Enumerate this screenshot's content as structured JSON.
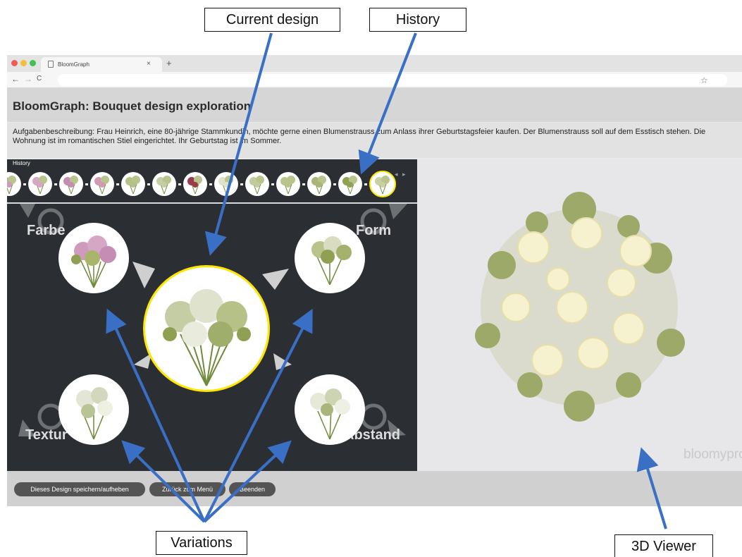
{
  "browser": {
    "tab_title": "BloomGraph",
    "tab_close": "×",
    "new_tab": "+",
    "nav_back": "←",
    "nav_forward": "→",
    "nav_reload": "C",
    "bookmark_icon": "☆"
  },
  "app": {
    "title": "BloomGraph: Bouquet design exploration",
    "task": "Aufgabenbeschreibung: Frau Heinrich, eine 80-jährige Stammkundin, möchte gerne einen Blumenstrauss zum Anlass ihrer Geburtstagsfeier kaufen. Der Blumenstrauss soll auf dem Esstisch stehen. Die Wohnung ist im romantischen Stiel eingerichtet. Ihr Geburtstag ist im Sommer."
  },
  "history": {
    "label": "History",
    "arrows": "◂ ▸"
  },
  "variations": {
    "color": "Farbe",
    "form": "Form",
    "texture": "Textur",
    "spacing": "Abstand"
  },
  "viewer": {
    "watermark": "bloomypro"
  },
  "buttons": {
    "save": "Dieses Design speichern/aufheben",
    "menu": "Zurück zum Menü",
    "end": "Beenden"
  },
  "callouts": {
    "current": "Current design",
    "history": "History",
    "variations": "Variations",
    "viewer3d": "3D Viewer"
  },
  "colors": {
    "highlight": "#ffe600",
    "arrow": "#3a6fc6",
    "panel_bg": "#2b2f33"
  }
}
